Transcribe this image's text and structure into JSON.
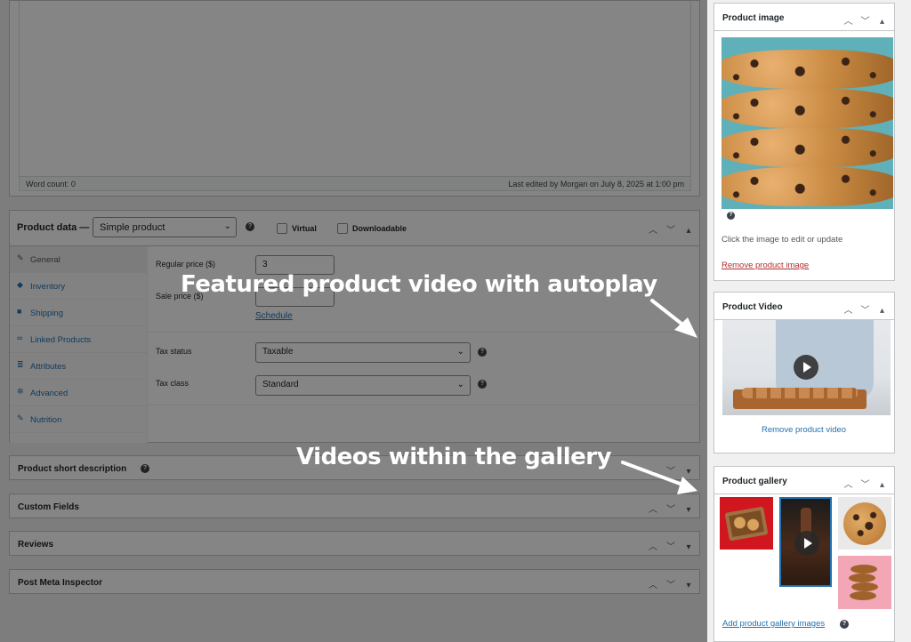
{
  "editor": {
    "word_count": "Word count: 0",
    "last_edited": "Last edited by Morgan on July 8, 2025 at 1:00 pm"
  },
  "product_data": {
    "title": "Product data —",
    "type_select": "Simple product",
    "virtual_label": "Virtual",
    "downloadable_label": "Downloadable",
    "tabs": [
      {
        "label": "General",
        "icon": "wrench-icon"
      },
      {
        "label": "Inventory",
        "icon": "tag-icon"
      },
      {
        "label": "Shipping",
        "icon": "truck-icon"
      },
      {
        "label": "Linked Products",
        "icon": "link-icon"
      },
      {
        "label": "Attributes",
        "icon": "list-icon"
      },
      {
        "label": "Advanced",
        "icon": "gear-icon"
      },
      {
        "label": "Nutrition",
        "icon": "wrench-icon"
      }
    ],
    "regular_price_label": "Regular price ($)",
    "regular_price_value": "3",
    "sale_price_label": "Sale price ($)",
    "schedule_link": "Schedule",
    "tax_status_label": "Tax status",
    "tax_status_value": "Taxable",
    "tax_class_label": "Tax class",
    "tax_class_value": "Standard"
  },
  "meta_boxes": [
    {
      "title": "Product short description"
    },
    {
      "title": "Custom Fields"
    },
    {
      "title": "Reviews"
    },
    {
      "title": "Post Meta Inspector"
    }
  ],
  "sidebar": {
    "product_image": {
      "title": "Product image",
      "hint": "Click the image to edit or update",
      "remove_link": "Remove product image"
    },
    "product_video": {
      "title": "Product Video",
      "remove_link": "Remove product video"
    },
    "product_gallery": {
      "title": "Product gallery",
      "add_link": "Add product gallery images"
    }
  },
  "annotations": {
    "featured": "Featured product video with autoplay",
    "gallery": "Videos within the gallery"
  },
  "colors": {
    "link": "#2271b1",
    "overlay": "rgba(0,0,0,0.48)"
  }
}
